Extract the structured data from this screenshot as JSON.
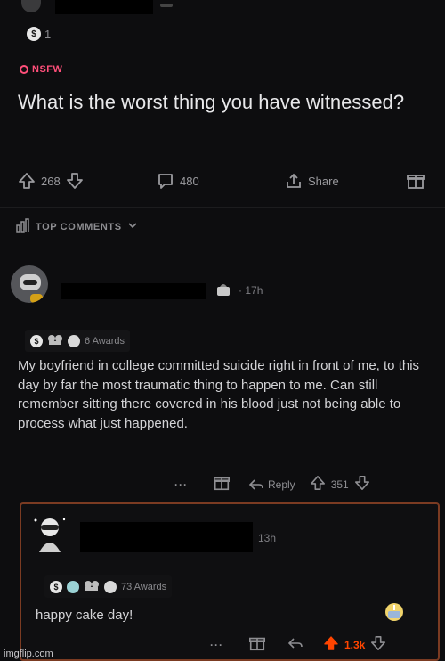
{
  "post": {
    "award_count": "1",
    "nsfw_label": "NSFW",
    "title": "What is the worst thing you have witnessed?",
    "upvotes": "268",
    "comments": "480",
    "share_label": "Share"
  },
  "sort": {
    "label": "TOP COMMENTS"
  },
  "comment1": {
    "time": "17h",
    "awards": "6 Awards",
    "body": "My boyfriend in college committed suicide right in front of me, to this day by far the most traumatic thing to happen to me. Can still remember sitting there covered in his blood just not being able to process what just happened.",
    "more": "···",
    "reply_label": "Reply",
    "votes": "351"
  },
  "comment2": {
    "time": "13h",
    "awards": "73 Awards",
    "body": "happy cake day!",
    "more": "···",
    "votes": "1.3k"
  },
  "watermark": "imgflip.com",
  "colors": {
    "background": "#0d0d0f",
    "nsfw": "#ff4f7a",
    "upvoted": "#ff4500",
    "reply_border": "#7b3b22"
  }
}
